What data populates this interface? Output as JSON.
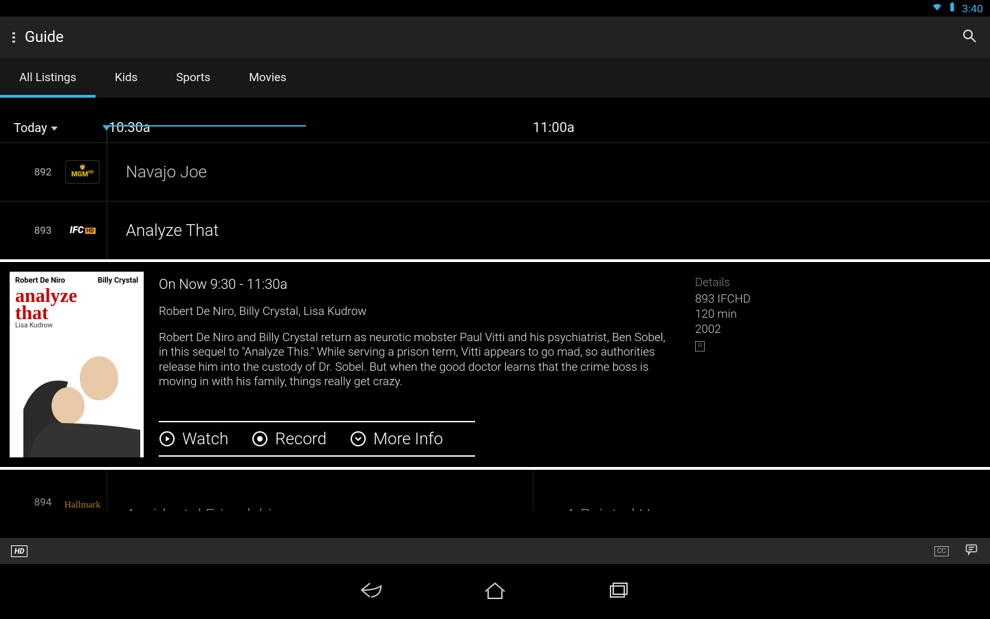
{
  "status": {
    "time": "3:40"
  },
  "header": {
    "title": "Guide"
  },
  "filters": [
    "All Listings",
    "Kids",
    "Sports",
    "Movies"
  ],
  "timebar": {
    "day": "Today",
    "slot1": "10:30a",
    "slot2": "11:00a"
  },
  "rows": [
    {
      "num": "892",
      "logo": "MGM",
      "logo_sub": "HD",
      "prog1": "Navajo Joe"
    },
    {
      "num": "893",
      "logo": "IFC",
      "logo_sub": "HD",
      "prog1": "Analyze That"
    }
  ],
  "detail": {
    "poster": {
      "name_left": "Robert De Niro",
      "name_right": "Billy Crystal",
      "title1": "analyze",
      "title2": "that",
      "sub": "Lisa Kudrow"
    },
    "on_now": "On Now 9:30 - 11:30a",
    "cast": "Robert De Niro, Billy Crystal, Lisa Kudrow",
    "desc": "Robert De Niro and Billy Crystal return as neurotic mobster Paul Vitti and his psychiatrist, Ben Sobel, in this sequel to \"Analyze This.\" While serving a prison term, Vitti appears to go mad, so authorities release him into the custody of Dr. Sobel. But when the good doctor learns that the crime boss is moving in with his family, things really get crazy.",
    "actions": {
      "watch": "Watch",
      "record": "Record",
      "more": "More Info"
    },
    "side": {
      "hdr": "Details",
      "channel": "893 IFCHD",
      "runtime": "120 min",
      "year": "2002",
      "rating": "R"
    }
  },
  "peek": {
    "num": "894",
    "logo": "Hallmark",
    "prog1": "Accidental Friendship",
    "prog2": "A Painted House"
  },
  "dock": {
    "hd": "HD",
    "cc": "CC"
  }
}
